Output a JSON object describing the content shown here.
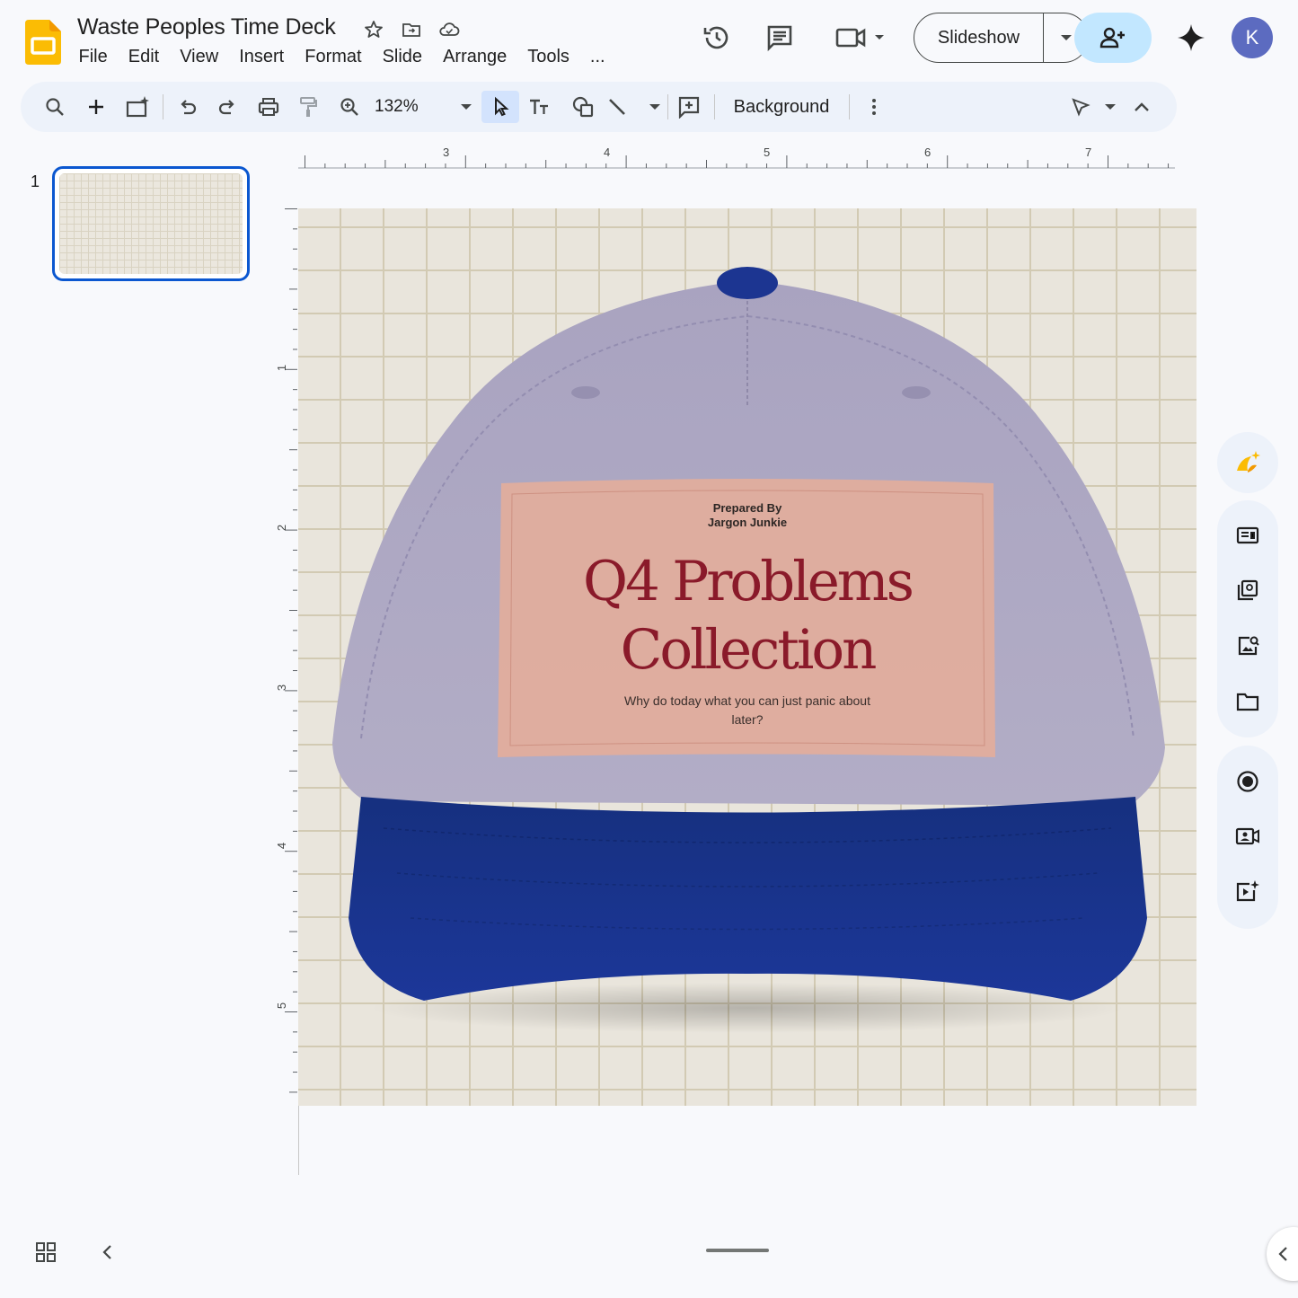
{
  "app": {
    "doc_title": "Waste Peoples Time Deck",
    "icons": {
      "app_logo": "slides-logo-icon",
      "star": "star-icon",
      "move": "move-to-folder-icon",
      "cloud": "cloud-saved-icon"
    }
  },
  "menu": [
    "File",
    "Edit",
    "View",
    "Insert",
    "Format",
    "Slide",
    "Arrange",
    "Tools",
    "..."
  ],
  "header": {
    "slideshow_label": "Slideshow",
    "avatar_letter": "K",
    "share_color": "#c2e7ff",
    "avatar_color": "#5c6bc0"
  },
  "toolbar": {
    "zoom": "132%",
    "background_label": "Background"
  },
  "filmstrip": {
    "slide_number": "1",
    "selected_border_color": "#0b57d0"
  },
  "ruler": {
    "horizontal_labels": [
      "3",
      "4",
      "5",
      "6",
      "7"
    ],
    "vertical_labels": [
      "1",
      "2",
      "3",
      "4",
      "5"
    ]
  },
  "slide": {
    "prepared_by_line1": "Prepared By",
    "prepared_by_line2": "Jargon Junkie",
    "title_line1": "Q4 Problems",
    "title_line2": "Collection",
    "tagline": "Why do today what you can just panic about later?",
    "colors": {
      "crown": "#aaa5bf",
      "brim": "#1b3591",
      "patch": "#e2ad9c",
      "title": "#8a1a2a",
      "background": "#e9e5dc"
    }
  }
}
